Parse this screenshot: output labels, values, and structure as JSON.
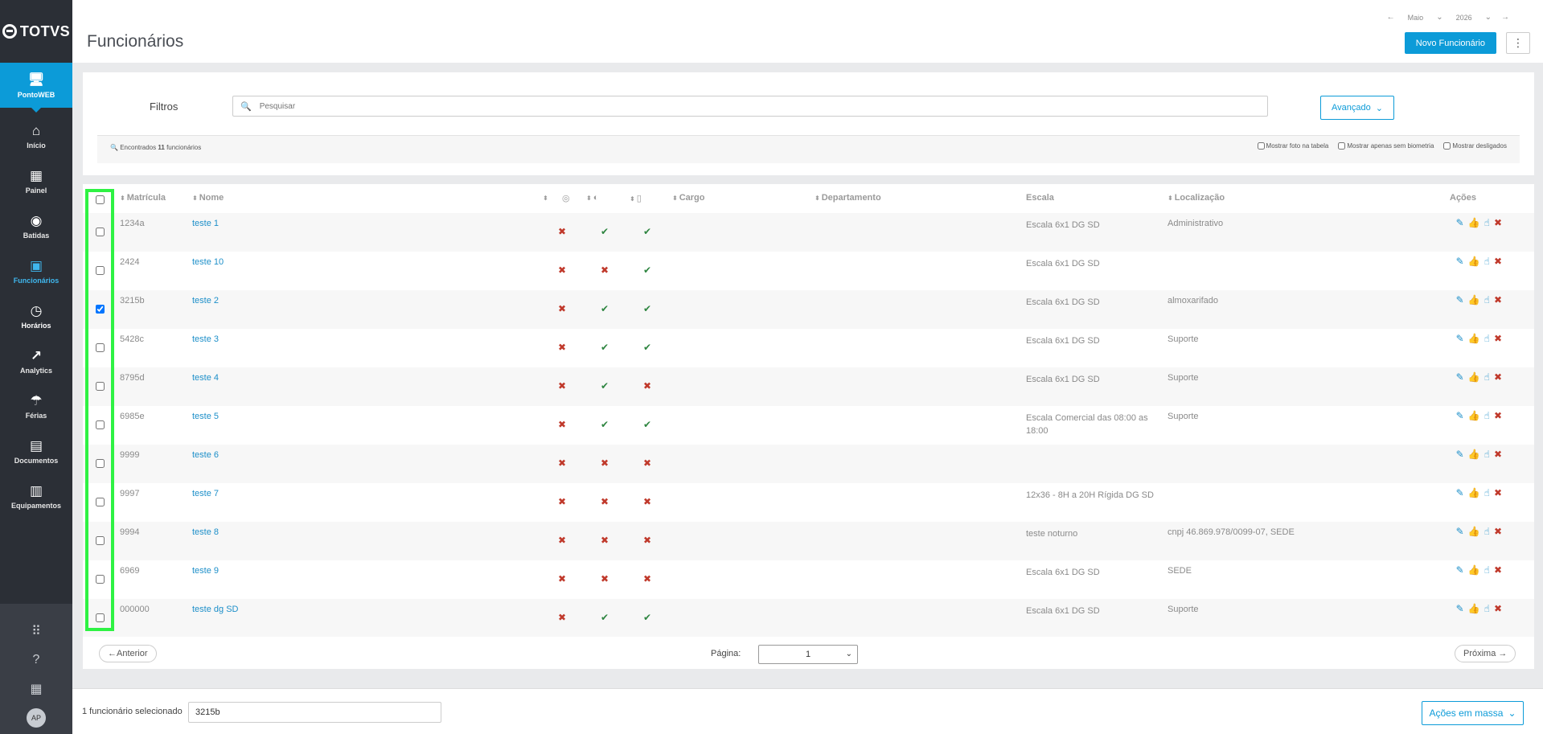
{
  "brand": {
    "name": "TOTVS"
  },
  "app": {
    "label": "PontoWEB",
    "icon": "monitor-icon"
  },
  "nav": [
    {
      "label": "Início",
      "icon": "home-icon"
    },
    {
      "label": "Painel",
      "icon": "dashboard-icon"
    },
    {
      "label": "Batidas",
      "icon": "fingerprint-icon"
    },
    {
      "label": "Funcionários",
      "icon": "badge-icon"
    },
    {
      "label": "Horários",
      "icon": "clock-icon"
    },
    {
      "label": "Analytics",
      "icon": "trend-icon"
    },
    {
      "label": "Férias",
      "icon": "umbrella-icon"
    },
    {
      "label": "Documentos",
      "icon": "document-icon"
    },
    {
      "label": "Equipamentos",
      "icon": "device-icon"
    }
  ],
  "header": {
    "title": "Funcionários",
    "month": "Maio",
    "year": "2026",
    "new_button": "Novo Funcionário"
  },
  "filters": {
    "label": "Filtros",
    "search_placeholder": "Pesquisar",
    "advanced": "Avançado",
    "found_prefix": "Encontrados",
    "found_count": "11",
    "found_suffix": "funcionários",
    "options": [
      "Mostrar foto na tabela",
      "Mostrar apenas sem biometria",
      "Mostrar desligados"
    ]
  },
  "table": {
    "headers": {
      "matricula": "Matrícula",
      "nome": "Nome",
      "cargo": "Cargo",
      "departamento": "Departamento",
      "escala": "Escala",
      "localizacao": "Localização",
      "acoes": "Ações"
    },
    "rows": [
      {
        "matricula": "1234a",
        "nome": "teste 1",
        "i1": false,
        "i2": true,
        "i3": true,
        "escala": "Escala 6x1 DG SD",
        "localizacao": "Administrativo",
        "checked": false
      },
      {
        "matricula": "2424",
        "nome": "teste 10",
        "i1": false,
        "i2": false,
        "i3": true,
        "escala": "Escala 6x1 DG SD",
        "localizacao": "",
        "checked": false
      },
      {
        "matricula": "3215b",
        "nome": "teste 2",
        "i1": false,
        "i2": true,
        "i3": true,
        "escala": "Escala 6x1 DG SD",
        "localizacao": "almoxarifado",
        "checked": true
      },
      {
        "matricula": "5428c",
        "nome": "teste 3",
        "i1": false,
        "i2": true,
        "i3": true,
        "escala": "Escala 6x1 DG SD",
        "localizacao": "Suporte",
        "checked": false
      },
      {
        "matricula": "8795d",
        "nome": "teste 4",
        "i1": false,
        "i2": true,
        "i3": false,
        "escala": "Escala 6x1 DG SD",
        "localizacao": "Suporte",
        "checked": false
      },
      {
        "matricula": "6985e",
        "nome": "teste 5",
        "i1": false,
        "i2": true,
        "i3": true,
        "escala": "Escala Comercial das 08:00 as 18:00",
        "localizacao": "Suporte",
        "checked": false
      },
      {
        "matricula": "9999",
        "nome": "teste 6",
        "i1": false,
        "i2": false,
        "i3": false,
        "escala": "",
        "localizacao": "",
        "checked": false
      },
      {
        "matricula": "9997",
        "nome": "teste 7",
        "i1": false,
        "i2": false,
        "i3": false,
        "escala": "12x36 - 8H a 20H Rígida DG SD",
        "localizacao": "",
        "checked": false
      },
      {
        "matricula": "9994",
        "nome": "teste 8",
        "i1": false,
        "i2": false,
        "i3": false,
        "escala": "teste noturno",
        "localizacao": "cnpj 46.869.978/0099-07, SEDE",
        "checked": false
      },
      {
        "matricula": "6969",
        "nome": "teste 9",
        "i1": false,
        "i2": false,
        "i3": false,
        "escala": "Escala 6x1 DG SD",
        "localizacao": "SEDE",
        "checked": false
      },
      {
        "matricula": "000000",
        "nome": "teste dg SD",
        "i1": false,
        "i2": true,
        "i3": true,
        "escala": "Escala 6x1 DG SD",
        "localizacao": "Suporte",
        "checked": false
      }
    ]
  },
  "pager": {
    "prev": "←Anterior",
    "label": "Página:",
    "current": "1",
    "next": "Próxima →"
  },
  "bottom": {
    "selected_text": "1 funcionário selecionado",
    "selected_value": "3215b",
    "mass_actions": "Ações em massa"
  },
  "user": {
    "initials": "AP"
  },
  "colors": {
    "accent": "#0c9bd8",
    "sidebar": "#2b2f36",
    "error": "#c0392b",
    "success": "#2e8540",
    "highlight": "#2ef243"
  }
}
